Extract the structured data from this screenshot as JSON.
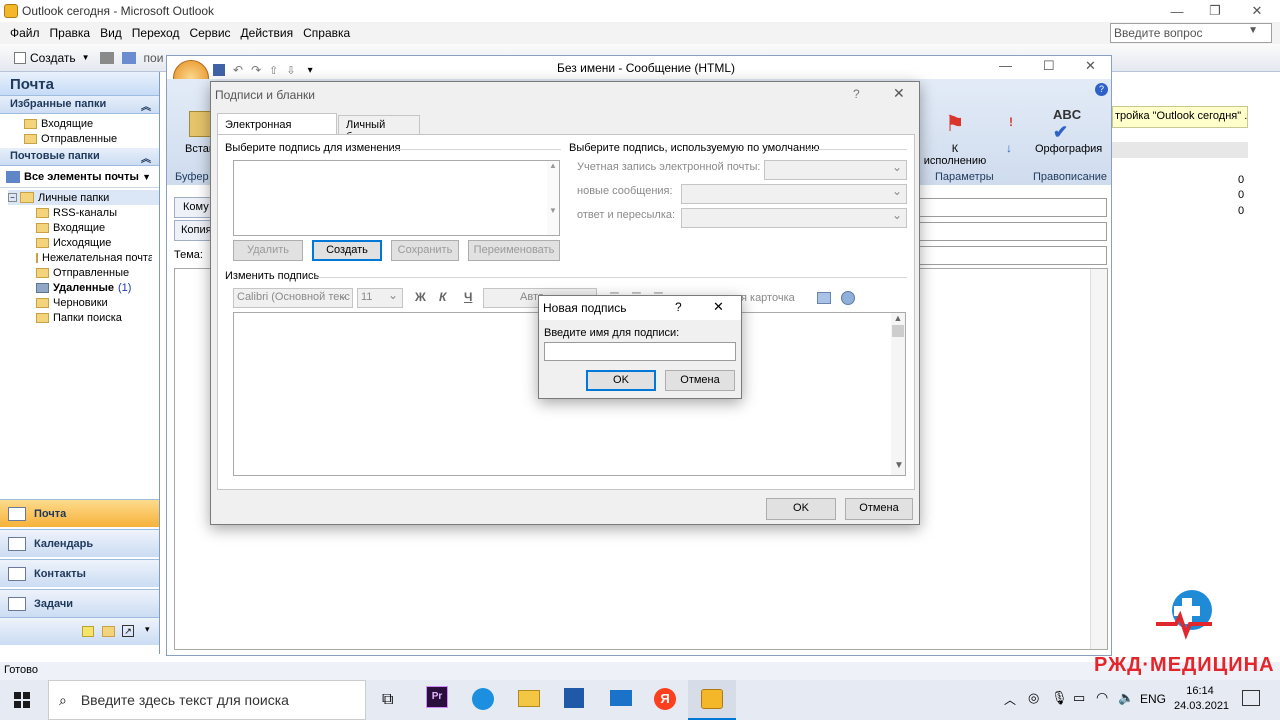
{
  "app": {
    "title": "Outlook сегодня - Microsoft Outlook",
    "help_placeholder": "Введите вопрос"
  },
  "menu": [
    "Файл",
    "Правка",
    "Вид",
    "Переход",
    "Сервис",
    "Действия",
    "Справка"
  ],
  "toolbar": {
    "create": "Создать",
    "search_partial": "пои"
  },
  "nav": {
    "header": "Почта",
    "favorites_title": "Избранные папки",
    "favorites": [
      "Входящие",
      "Отправленные"
    ],
    "mail_folders_title": "Почтовые папки",
    "all_items": "Все элементы почты",
    "personal": "Личные папки",
    "folders": [
      {
        "name": "RSS-каналы",
        "icon": "rss-folder-icon"
      },
      {
        "name": "Входящие",
        "icon": "inbox-folder-icon"
      },
      {
        "name": "Исходящие",
        "icon": "outbox-folder-icon"
      },
      {
        "name": "Нежелательная почта",
        "icon": "junk-folder-icon"
      },
      {
        "name": "Отправленные",
        "icon": "sent-folder-icon"
      },
      {
        "name": "Удаленные",
        "icon": "deleted-folder-icon",
        "count": "(1)"
      },
      {
        "name": "Черновики",
        "icon": "drafts-folder-icon"
      },
      {
        "name": "Папки поиска",
        "icon": "search-folder-icon"
      }
    ],
    "buttons": [
      "Почта",
      "Календарь",
      "Контакты",
      "Задачи"
    ]
  },
  "status": "Готово",
  "message": {
    "title": "Без имени - Сообщение (HTML)",
    "ribbon_insert": "Встав",
    "ribbon_buffer": "Буфер о",
    "followup": "К исполнению",
    "params": "Параметры",
    "spelling": "Орфография",
    "spelling_group": "Правописание",
    "to": "Кому",
    "cc": "Копия",
    "subject": "Тема:"
  },
  "yellow_note": "тройка \"Outlook сегодня\" ...",
  "right_counts": [
    "0",
    "0",
    "0"
  ],
  "sig_dialog": {
    "title": "Подписи и бланки",
    "tabs": [
      "Электронная подпись",
      "Личный бланк"
    ],
    "select_label": "Выберите подпись для изменения",
    "btn_delete": "Удалить",
    "btn_create": "Создать",
    "btn_save": "Сохранить",
    "btn_rename": "Переименовать",
    "default_label": "Выберите подпись, используемую по умолчанию",
    "account_label": "Учетная запись электронной почты:",
    "new_msg_label": "новые сообщения:",
    "reply_label": "ответ и пересылка:",
    "edit_label": "Изменить подпись",
    "font": "Calibri (Основной текс",
    "size": "11",
    "bold": "Ж",
    "italic": "К",
    "underline": "Ч",
    "color": "Авто",
    "card_partial": "я карточка",
    "ok": "OK",
    "cancel": "Отмена"
  },
  "new_sig_dialog": {
    "title": "Новая подпись",
    "help": "?",
    "prompt": "Введите имя для подписи:",
    "ok": "OK",
    "cancel": "Отмена"
  },
  "taskbar": {
    "search_placeholder": "Введите здесь текст для поиска",
    "lang": "ENG",
    "time": "16:14",
    "date": "24.03.2021"
  },
  "watermark": "РЖД·МЕДИЦИНА",
  "colors": {
    "accent": "#0078d7",
    "nav_active": "#f7b23a",
    "watermark": "#e3262b"
  }
}
